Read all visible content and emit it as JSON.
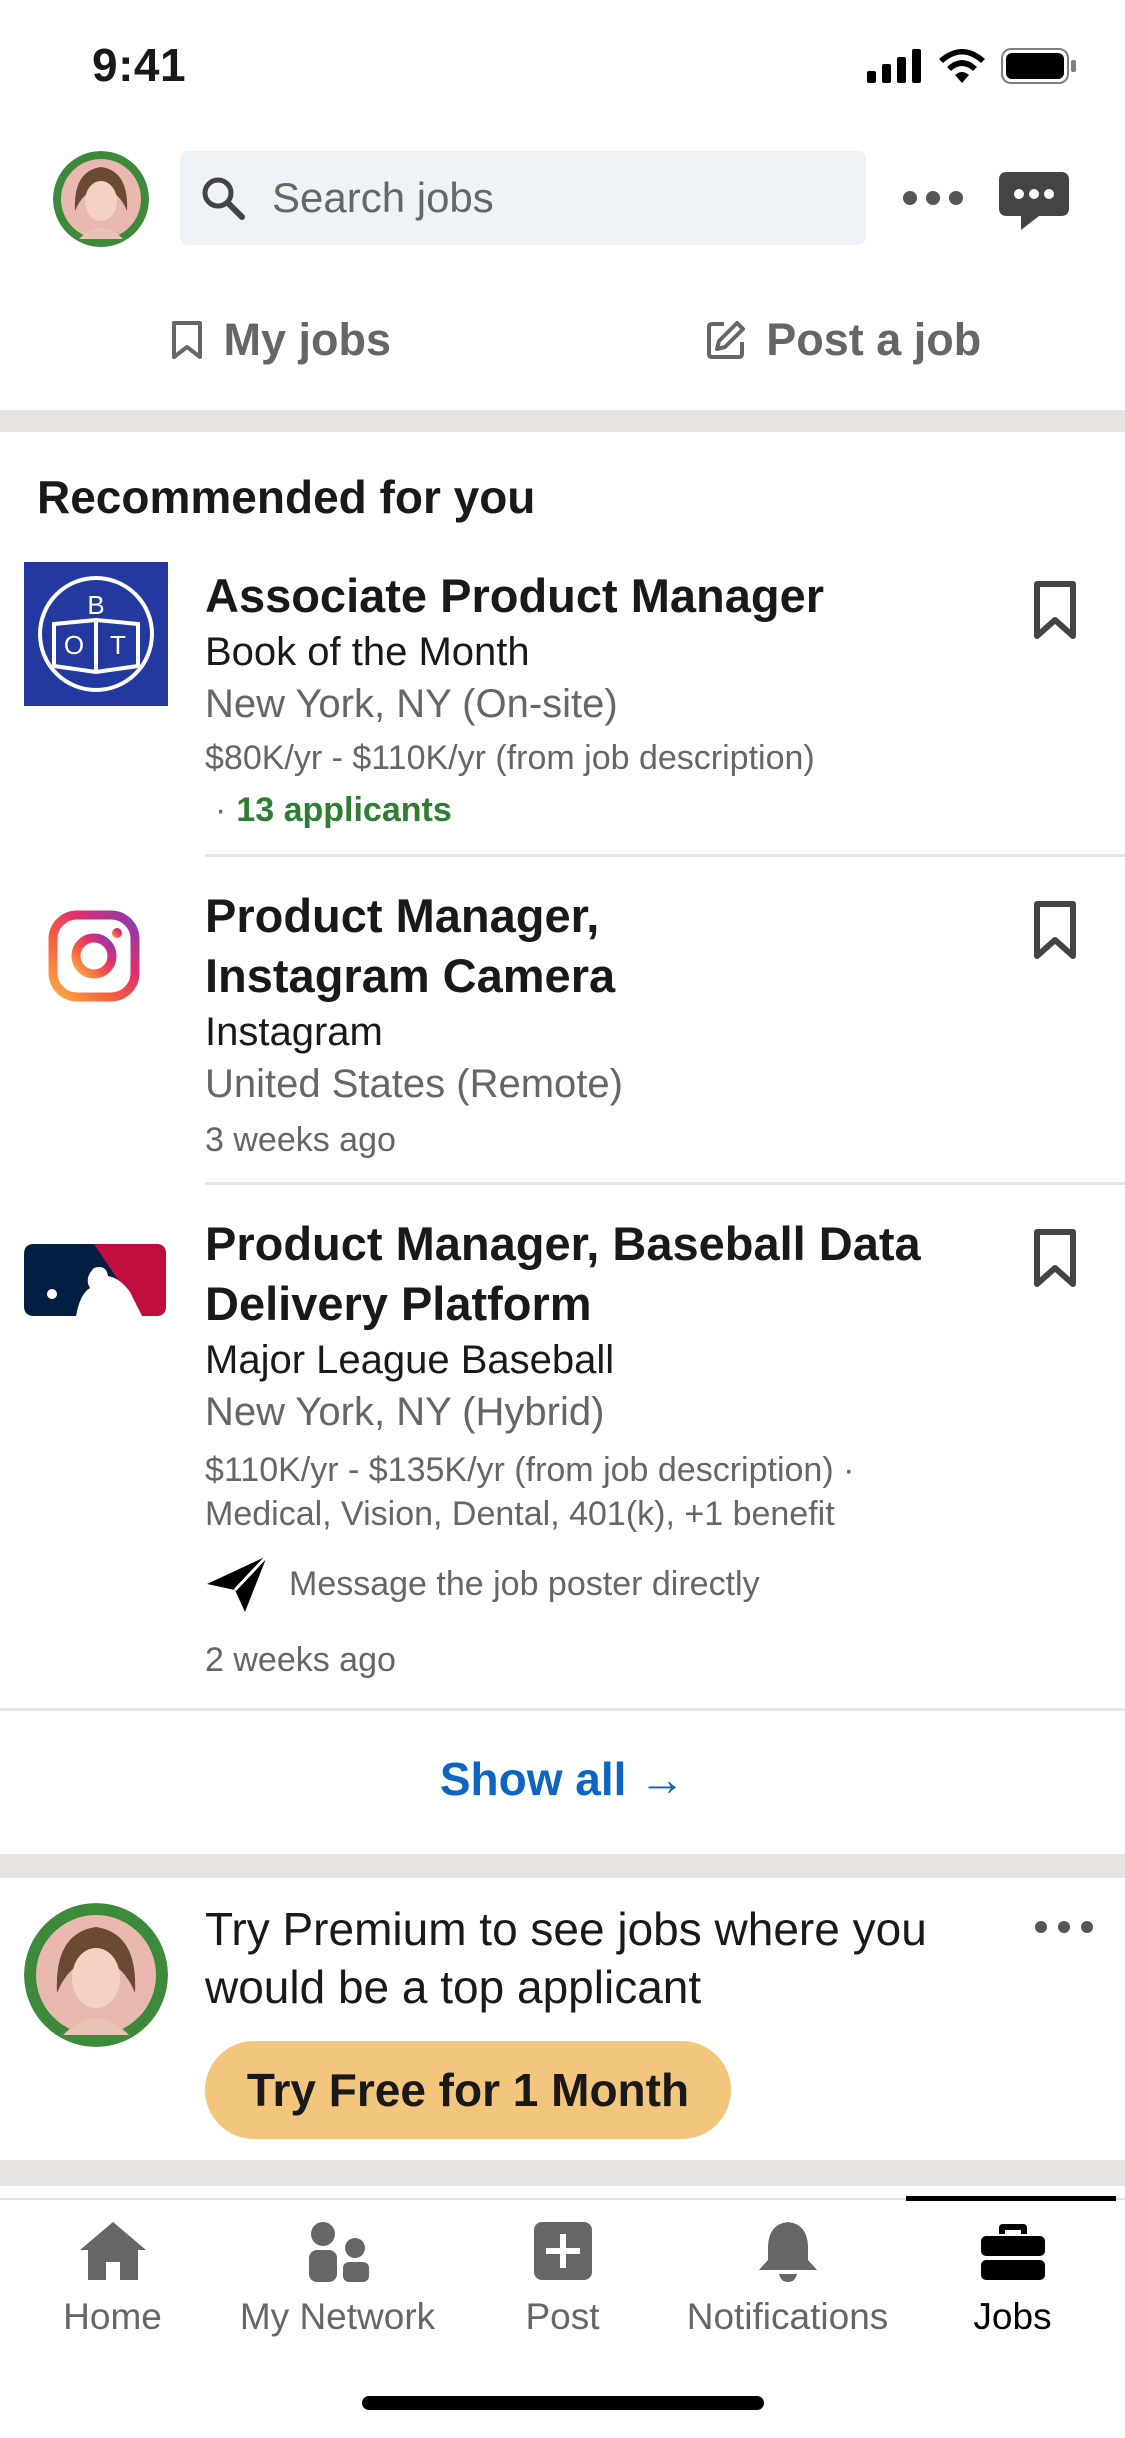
{
  "status_bar": {
    "time": "9:41"
  },
  "header": {
    "search_placeholder": "Search jobs"
  },
  "tabs": [
    {
      "label": "My jobs",
      "icon": "bookmark-icon"
    },
    {
      "label": "Post a job",
      "icon": "edit-icon"
    }
  ],
  "recommended": {
    "title": "Recommended for you",
    "jobs": [
      {
        "title": "Associate Product Manager",
        "company": "Book of the Month",
        "location": "New York, NY (On-site)",
        "salary": "$80K/yr - $110K/yr (from job description)",
        "applicants": "13 applicants"
      },
      {
        "title_line1": "Product Manager,",
        "title_line2": "Instagram Camera",
        "company": "Instagram",
        "location": "United States (Remote)",
        "posted": "3 weeks ago"
      },
      {
        "title_line1": "Product Manager, Baseball Data",
        "title_line2": "Delivery Platform",
        "company": "Major League Baseball",
        "location": "New York, NY (Hybrid)",
        "salary": "$110K/yr - $135K/yr (from job description) ·",
        "benefits": "Medical, Vision, Dental, 401(k), +1 benefit",
        "message": "Message the job poster directly",
        "posted": "2 weeks ago"
      }
    ],
    "show_all": "Show all →"
  },
  "premium": {
    "text": "Try Premium to see jobs where you would be a top applicant",
    "button": "Try Free for 1 Month"
  },
  "nav": [
    {
      "label": "Home",
      "icon": "home-icon"
    },
    {
      "label": "My Network",
      "icon": "network-icon"
    },
    {
      "label": "Post",
      "icon": "post-icon"
    },
    {
      "label": "Notifications",
      "icon": "bell-icon"
    },
    {
      "label": "Jobs",
      "icon": "briefcase-icon",
      "active": true
    }
  ],
  "colors": {
    "accent": "#0a66c2",
    "green": "#2e7d32",
    "premium": "#f3c67e",
    "band": "#e8e4df"
  }
}
